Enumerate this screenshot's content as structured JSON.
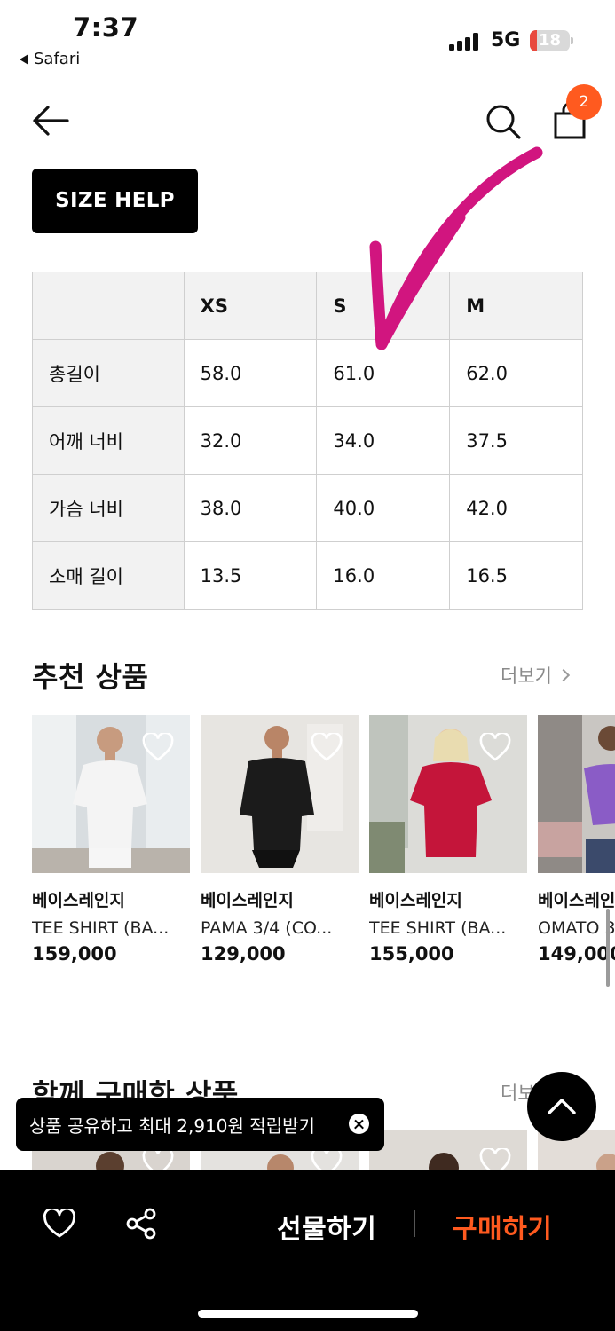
{
  "status_bar": {
    "time": "7:37",
    "back_app": "Safari",
    "network": "5G",
    "battery": "18",
    "battery_level": 0.18,
    "battery_color": "#e84a3f"
  },
  "header": {
    "back_icon": "arrow-left-icon",
    "search_icon": "search-icon",
    "cart_icon": "shopping-bag-icon",
    "cart_count": "2",
    "badge_color": "#ff5a1f"
  },
  "size_help": {
    "label": "SIZE HELP"
  },
  "size_table": {
    "columns": [
      "XS",
      "S",
      "M"
    ],
    "rows": [
      {
        "label": "총길이",
        "values": [
          "58.0",
          "61.0",
          "62.0"
        ]
      },
      {
        "label": "어깨 너비",
        "values": [
          "32.0",
          "34.0",
          "37.5"
        ]
      },
      {
        "label": "가슴 너비",
        "values": [
          "38.0",
          "40.0",
          "42.0"
        ]
      },
      {
        "label": "소매 길이",
        "values": [
          "13.5",
          "16.0",
          "16.5"
        ]
      }
    ]
  },
  "annotation": {
    "color": "#d1157f",
    "type": "hand-drawn-arrow"
  },
  "recommended": {
    "title": "추천 상품",
    "more_label": "더보기",
    "products": [
      {
        "brand": "베이스레인지",
        "name": "TEE SHIRT (BA...",
        "price": "159,000",
        "shirt_color": "#f4f4f4"
      },
      {
        "brand": "베이스레인지",
        "name": "PAMA 3/4 (CO...",
        "price": "129,000",
        "shirt_color": "#1b1b1b"
      },
      {
        "brand": "베이스레인지",
        "name": "TEE SHIRT (BA...",
        "price": "155,000",
        "shirt_color": "#c4153a"
      },
      {
        "brand": "베이스레인지",
        "name": "OMATO 3",
        "price": "149,000",
        "shirt_color": "#8a5cc6"
      }
    ]
  },
  "bought_together": {
    "title": "함께 구매한 상품",
    "more_label": "더보"
  },
  "toast": {
    "message": "상품 공유하고 최대 2,910원 적립받기"
  },
  "bottom_bar": {
    "gift_label": "선물하기",
    "buy_label": "구매하기",
    "accent_color": "#ff5a1f"
  }
}
